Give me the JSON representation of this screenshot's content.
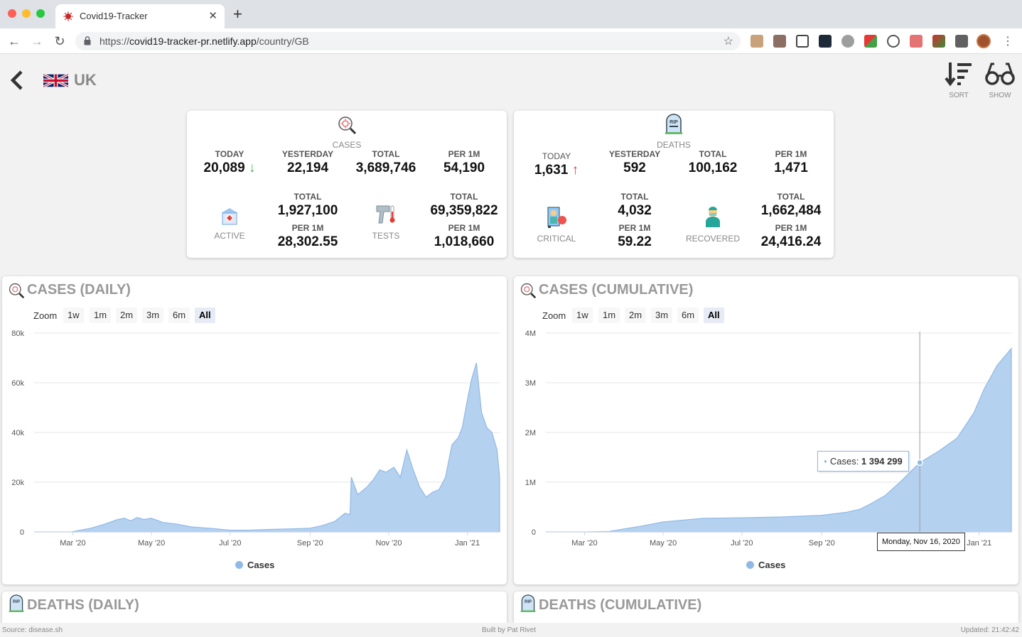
{
  "browser": {
    "tab_title": "Covid19-Tracker",
    "url_prefix": "https://",
    "url_host": "covid19-tracker-pr.netlify.app",
    "url_path": "/country/GB"
  },
  "header": {
    "country": "UK",
    "sort_label": "SORT",
    "show_label": "SHOW"
  },
  "cases_card": {
    "title": "CASES",
    "today_label": "TODAY",
    "today_value": "20,089",
    "today_trend": "down",
    "yesterday_label": "YESTERDAY",
    "yesterday_value": "22,194",
    "total_label": "TOTAL",
    "total_value": "3,689,746",
    "per1m_label": "PER 1M",
    "per1m_value": "54,190",
    "active_title": "ACTIVE",
    "active_total_label": "TOTAL",
    "active_total_value": "1,927,100",
    "active_per1m_label": "PER 1M",
    "active_per1m_value": "28,302.55",
    "tests_title": "TESTS",
    "tests_total_label": "TOTAL",
    "tests_total_value": "69,359,822",
    "tests_per1m_label": "PER 1M",
    "tests_per1m_value": "1,018,660"
  },
  "deaths_card": {
    "title": "DEATHS",
    "today_label": "TODAY",
    "today_value": "1,631",
    "today_trend": "up",
    "yesterday_label": "YESTERDAY",
    "yesterday_value": "592",
    "total_label": "TOTAL",
    "total_value": "100,162",
    "per1m_label": "PER 1M",
    "per1m_value": "1,471",
    "critical_title": "CRITICAL",
    "critical_total_label": "TOTAL",
    "critical_total_value": "4,032",
    "critical_per1m_label": "PER 1M",
    "critical_per1m_value": "59.22",
    "recovered_title": "RECOVERED",
    "recovered_total_label": "TOTAL",
    "recovered_total_value": "1,662,484",
    "recovered_per1m_label": "PER 1M",
    "recovered_per1m_value": "24,416.24"
  },
  "zoom": {
    "label": "Zoom",
    "options": [
      "1w",
      "1m",
      "2m",
      "3m",
      "6m",
      "All"
    ],
    "active": "All"
  },
  "tooltip": {
    "series": "Cases: ",
    "value": "1 394 299",
    "date": "Monday, Nov 16, 2020"
  },
  "lower": {
    "deaths_daily_title": "DEATHS (DAILY)",
    "deaths_cumulative_title": "DEATHS (CUMULATIVE)"
  },
  "footer": {
    "source": "Source: disease.sh",
    "built_by": "Built by Pat Rivet",
    "updated": "Updated: 21:42:42"
  },
  "colors": {
    "area_fill": "#b5d1f0",
    "area_line": "#90b9e6"
  },
  "chart_data": [
    {
      "type": "area",
      "title": "CASES (DAILY)",
      "xlabel": "",
      "ylabel": "",
      "x_ticks": [
        "Mar '20",
        "May '20",
        "Jul '20",
        "Sep '20",
        "Nov '20",
        "Jan '21"
      ],
      "y_ticks": [
        "0",
        "20k",
        "40k",
        "60k",
        "80k"
      ],
      "ylim": [
        0,
        80000
      ],
      "xlim": [
        "2020-01-31",
        "2021-01-26"
      ],
      "grid": true,
      "legend": "bottom",
      "series": [
        {
          "name": "Cases",
          "x": [
            "2020-01-31",
            "2020-02-29",
            "2020-03-15",
            "2020-03-25",
            "2020-04-05",
            "2020-04-10",
            "2020-04-15",
            "2020-04-20",
            "2020-04-25",
            "2020-05-01",
            "2020-05-10",
            "2020-05-20",
            "2020-06-01",
            "2020-06-15",
            "2020-07-01",
            "2020-07-15",
            "2020-08-01",
            "2020-08-15",
            "2020-09-01",
            "2020-09-10",
            "2020-09-20",
            "2020-09-28",
            "2020-10-02",
            "2020-10-03",
            "2020-10-08",
            "2020-10-15",
            "2020-10-20",
            "2020-10-25",
            "2020-10-30",
            "2020-11-05",
            "2020-11-10",
            "2020-11-15",
            "2020-11-20",
            "2020-11-25",
            "2020-11-30",
            "2020-12-05",
            "2020-12-10",
            "2020-12-15",
            "2020-12-20",
            "2020-12-25",
            "2020-12-28",
            "2021-01-01",
            "2021-01-04",
            "2021-01-08",
            "2021-01-12",
            "2021-01-16",
            "2021-01-20",
            "2021-01-24",
            "2021-01-26"
          ],
          "y": [
            0,
            30,
            1500,
            3000,
            5000,
            5500,
            4500,
            5800,
            5000,
            5500,
            3800,
            3200,
            2000,
            1500,
            700,
            700,
            1000,
            1200,
            1500,
            2500,
            4200,
            7500,
            7000,
            22000,
            15000,
            18000,
            21000,
            25000,
            24000,
            26000,
            22000,
            33000,
            25000,
            18000,
            14000,
            16000,
            17000,
            22000,
            35000,
            38000,
            42000,
            53000,
            61000,
            68000,
            48000,
            42000,
            40000,
            33000,
            22000
          ]
        }
      ]
    },
    {
      "type": "area",
      "title": "CASES (CUMULATIVE)",
      "xlabel": "",
      "ylabel": "",
      "x_ticks": [
        "Mar '20",
        "May '20",
        "Jul '20",
        "Sep '20",
        "Nov '20",
        "Jan '21"
      ],
      "y_ticks": [
        "0",
        "1M",
        "2M",
        "3M",
        "4M"
      ],
      "ylim": [
        0,
        4000000
      ],
      "xlim": [
        "2020-01-31",
        "2021-01-26"
      ],
      "grid": true,
      "legend": "bottom",
      "series": [
        {
          "name": "Cases",
          "x": [
            "2020-01-31",
            "2020-03-01",
            "2020-03-20",
            "2020-04-15",
            "2020-05-01",
            "2020-06-01",
            "2020-07-01",
            "2020-08-01",
            "2020-09-01",
            "2020-09-20",
            "2020-10-01",
            "2020-10-10",
            "2020-10-20",
            "2020-11-01",
            "2020-11-16",
            "2020-12-01",
            "2020-12-15",
            "2020-12-28",
            "2021-01-05",
            "2021-01-15",
            "2021-01-26"
          ],
          "y": [
            0,
            100,
            10000,
            120000,
            200000,
            275000,
            285000,
            300000,
            335000,
            395000,
            460000,
            580000,
            730000,
            1010000,
            1394299,
            1630000,
            1890000,
            2400000,
            2880000,
            3350000,
            3689746
          ]
        }
      ],
      "highlight": {
        "x": "2020-11-16",
        "y": 1394299
      }
    }
  ]
}
